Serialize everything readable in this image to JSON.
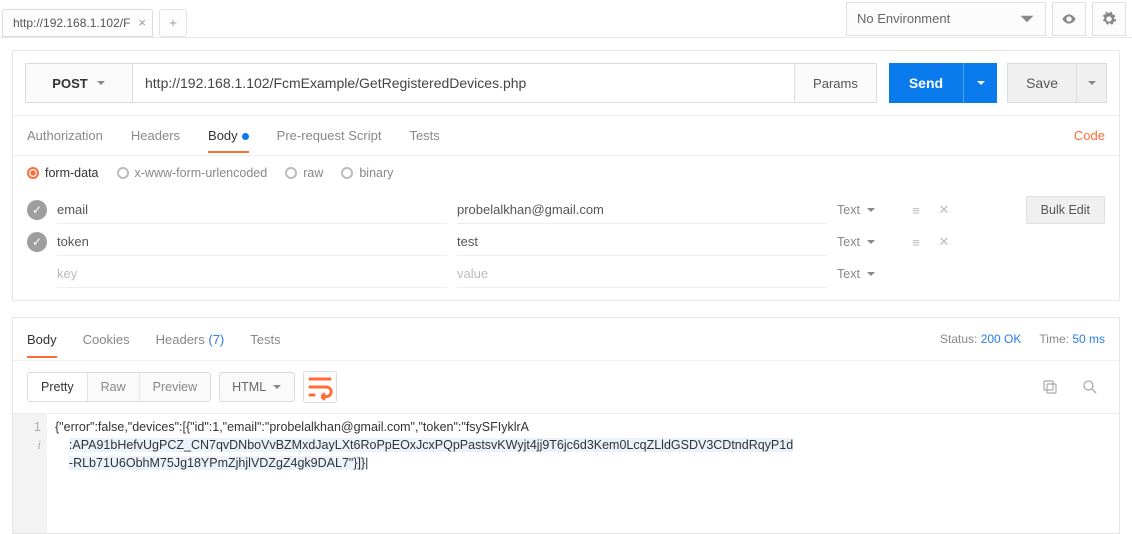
{
  "topbar": {
    "tab_title": "http://192.168.1.102/F",
    "environment": "No Environment"
  },
  "request": {
    "method": "POST",
    "url": "http://192.168.1.102/FcmExample/GetRegisteredDevices.php",
    "params_label": "Params",
    "send_label": "Send",
    "save_label": "Save"
  },
  "tabs": {
    "authorization": "Authorization",
    "headers": "Headers",
    "body": "Body",
    "prerequest": "Pre-request Script",
    "tests": "Tests",
    "code": "Code"
  },
  "body_types": {
    "formdata": "form-data",
    "urlencoded": "x-www-form-urlencoded",
    "raw": "raw",
    "binary": "binary"
  },
  "kv": {
    "bulk": "Bulk Edit",
    "rows": [
      {
        "key": "email",
        "value": "probelalkhan@gmail.com",
        "type": "Text"
      },
      {
        "key": "token",
        "value": "test",
        "type": "Text"
      }
    ],
    "placeholder_key": "key",
    "placeholder_value": "value",
    "placeholder_type": "Text"
  },
  "response": {
    "tabs": {
      "body": "Body",
      "cookies": "Cookies",
      "headers": "Headers",
      "headers_count": "(7)",
      "tests": "Tests"
    },
    "status_label": "Status:",
    "status_value": "200 OK",
    "time_label": "Time:",
    "time_value": "50 ms",
    "view": {
      "pretty": "Pretty",
      "raw": "Raw",
      "preview": "Preview"
    },
    "format": "HTML",
    "content_line1": "{\"error\":false,\"devices\":[{\"id\":1,\"email\":\"probelalkhan@gmail.com\",\"token\":\"fsySFIyklrA",
    "content_line2": ":APA91bHefvUgPCZ_CN7qvDNboVvBZMxdJayLXt6RoPpEOxJcxPQpPastsvKWyjt4jj9T6jc6d3Kem0LcqZLldGSDV3CDtndRqyP1d",
    "content_line3": "-RLb71U6ObhM75Jg18YPmZjhjlVDZgZ4gk9DAL7\"}]}"
  }
}
